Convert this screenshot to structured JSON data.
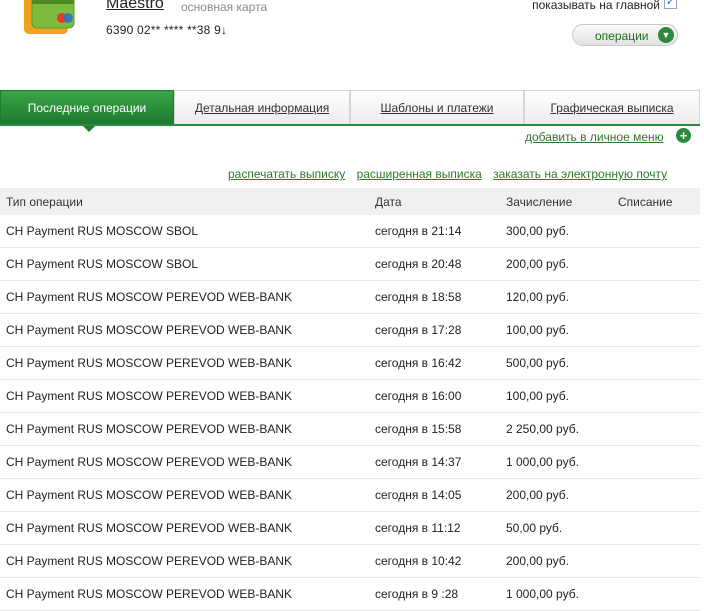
{
  "card": {
    "name": "Maestro",
    "type": "основная карта",
    "number": "6390 02** **** **38 9↓",
    "show_on_main_label": "показывать на главной",
    "show_on_main_checked": "✓",
    "operations_button": "операции"
  },
  "tabs": [
    {
      "label": "Последние операции"
    },
    {
      "label": "Детальная информация"
    },
    {
      "label": "Шаблоны и платежи"
    },
    {
      "label": "Графическая выписка"
    }
  ],
  "links": {
    "add_to_personal_menu": "добавить в личное меню",
    "print_statement": "распечатать выписку",
    "extended_statement": "расширенная выписка",
    "order_email": "заказать на электронную почту"
  },
  "table": {
    "headers": [
      "Тип операции",
      "Дата",
      "Зачисление",
      "Списание"
    ],
    "rows": [
      {
        "type": "CH Payment RUS MOSCOW SBOL",
        "date": "сегодня в 21:14",
        "credit": "300,00 руб.",
        "debit": ""
      },
      {
        "type": "CH Payment RUS MOSCOW SBOL",
        "date": "сегодня в 20:48",
        "credit": "200,00 руб.",
        "debit": ""
      },
      {
        "type": "CH Payment RUS MOSCOW PEREVOD WEB-BANK",
        "date": "сегодня в 18:58",
        "credit": "120,00 руб.",
        "debit": ""
      },
      {
        "type": "CH Payment RUS MOSCOW PEREVOD WEB-BANK",
        "date": "сегодня в 17:28",
        "credit": "100,00 руб.",
        "debit": ""
      },
      {
        "type": "CH Payment RUS MOSCOW PEREVOD WEB-BANK",
        "date": "сегодня в 16:42",
        "credit": "500,00 руб.",
        "debit": ""
      },
      {
        "type": "CH Payment RUS MOSCOW PEREVOD WEB-BANK",
        "date": "сегодня в 16:00",
        "credit": "100,00 руб.",
        "debit": ""
      },
      {
        "type": "CH Payment RUS MOSCOW PEREVOD WEB-BANK",
        "date": "сегодня в 15:58",
        "credit": "2 250,00 руб.",
        "debit": ""
      },
      {
        "type": "CH Payment RUS MOSCOW PEREVOD WEB-BANK",
        "date": "сегодня в 14:37",
        "credit": "1 000,00 руб.",
        "debit": ""
      },
      {
        "type": "CH Payment RUS MOSCOW PEREVOD WEB-BANK",
        "date": "сегодня в 14:05",
        "credit": "200,00 руб.",
        "debit": ""
      },
      {
        "type": "CH Payment RUS MOSCOW PEREVOD WEB-BANK",
        "date": "сегодня в 11:12",
        "credit": "50,00 руб.",
        "debit": ""
      },
      {
        "type": "CH Payment RUS MOSCOW PEREVOD WEB-BANK",
        "date": "сегодня в 10:42",
        "credit": "200,00 руб.",
        "debit": ""
      },
      {
        "type": "CH Payment RUS MOSCOW PEREVOD WEB-BANK",
        "date": "сегодня в 9 :28",
        "credit": "1 000,00 руб.",
        "debit": ""
      }
    ]
  },
  "colors": {
    "brand_green": "#2a8a3e",
    "link_green": "#2a7a2a"
  },
  "icons": {
    "card": "card-icon",
    "operations_chevron": "chevron-down-icon",
    "add": "plus-icon"
  }
}
